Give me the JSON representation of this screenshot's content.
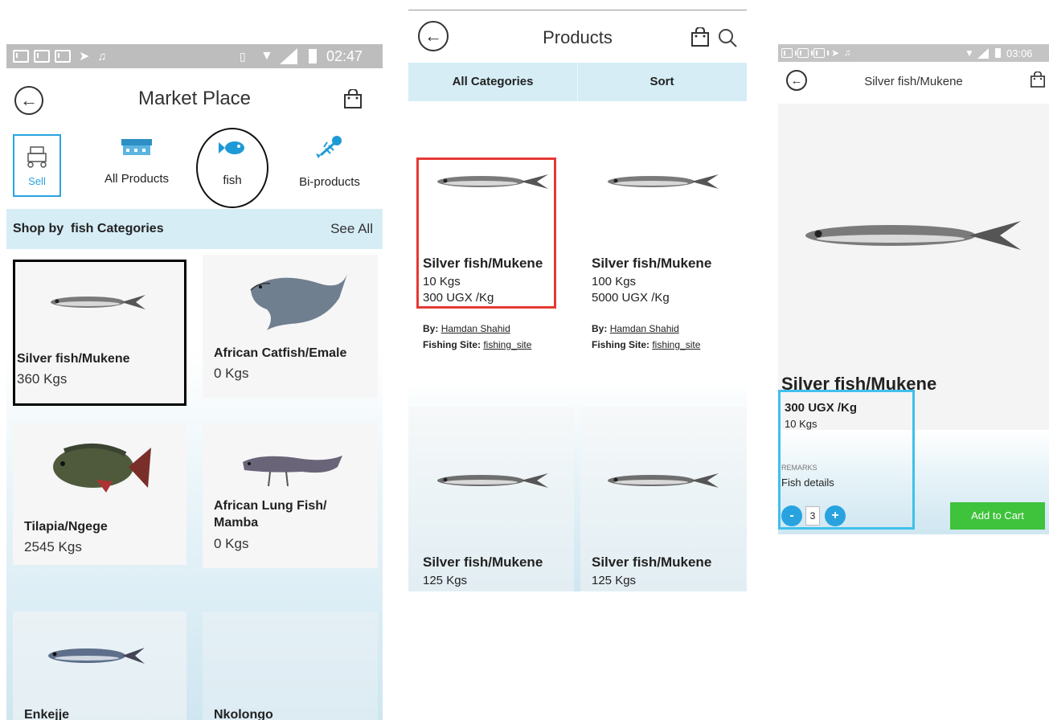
{
  "market": {
    "status_time": "02:47",
    "title": "Market Place",
    "tabs": [
      {
        "label": "Sell",
        "icon": "sell-stall-icon"
      },
      {
        "label": "All Products",
        "icon": "market-stall-icon"
      },
      {
        "label": "fish",
        "icon": "fish-icon"
      },
      {
        "label": "Bi-products",
        "icon": "fish-bone-icon"
      }
    ],
    "section_title": "Shop by  fish Categories",
    "see_all": "See All",
    "cards": [
      {
        "name": "Silver fish/Mukene",
        "qty": "360 Kgs"
      },
      {
        "name": "African Catfish/Emale",
        "qty": "0 Kgs"
      },
      {
        "name": "Tilapia/Ngege",
        "qty": "2545 Kgs"
      },
      {
        "name": "African Lung Fish/\nMamba",
        "qty": "0 Kgs"
      },
      {
        "name": "Enkejje",
        "qty": ""
      },
      {
        "name": "Nkolongo",
        "qty": ""
      }
    ]
  },
  "products": {
    "title": "Products",
    "filter_label": "All Categories",
    "sort_label": "Sort",
    "items": [
      {
        "name": "Silver fish/Mukene",
        "qty": "10 Kgs",
        "price": "300 UGX /Kg",
        "by_label": "By:",
        "by": "Hamdan Shahid",
        "site_label": "Fishing Site:",
        "site": "fishing_site"
      },
      {
        "name": "Silver fish/Mukene",
        "qty": "100 Kgs",
        "price": "5000 UGX /Kg",
        "by_label": "By:",
        "by": "Hamdan Shahid",
        "site_label": "Fishing Site:",
        "site": "fishing_site"
      },
      {
        "name": "Silver fish/Mukene",
        "qty": "125 Kgs"
      },
      {
        "name": "Silver fish/Mukene",
        "qty": "125 Kgs"
      }
    ]
  },
  "detail": {
    "status_time": "03:06",
    "title": "Silver fish/Mukene",
    "product_name": "Silver fish/Mukene",
    "price": "300 UGX /Kg",
    "qty": "10 Kgs",
    "remarks_label": "REMARKS",
    "remarks": "Fish details",
    "stepper_minus": "-",
    "stepper_value": "3",
    "stepper_plus": "+",
    "add_to_cart": "Add to Cart"
  },
  "colors": {
    "accent_blue": "#29a3e0",
    "header_light_blue": "#d6edf6",
    "add_to_cart_green": "#3fc23c",
    "highlight_red": "#e53935",
    "highlight_cyan": "#3fc0ea"
  }
}
